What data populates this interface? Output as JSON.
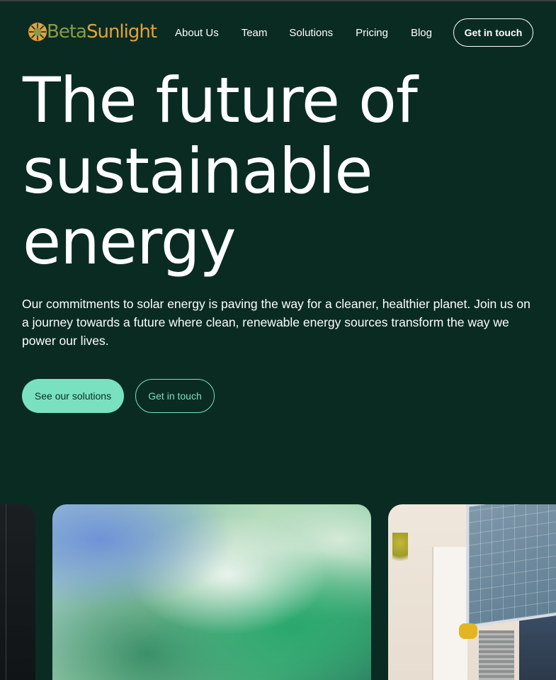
{
  "brand": {
    "name_part1": "Beta",
    "name_part2": "Sunlight",
    "logo_icon": "sun-icon",
    "colors": {
      "part1": "#8a9a45",
      "part2": "#e3a23a"
    }
  },
  "nav": {
    "items": [
      {
        "label": "About Us"
      },
      {
        "label": "Team"
      },
      {
        "label": "Solutions"
      },
      {
        "label": "Pricing"
      },
      {
        "label": "Blog"
      }
    ],
    "cta_label": "Get in touch"
  },
  "hero": {
    "title": "The future of sustainable energy",
    "subtitle": "Our commitments to solar energy is paving the way for a cleaner, healthier planet. Join us on a journey towards a future where clean, renewable energy sources transform the way we power our lives.",
    "primary_button": "See our solutions",
    "secondary_button": "Get in touch"
  },
  "colors": {
    "background": "#0a2b22",
    "accent": "#79e1bf",
    "text": "#ffffff"
  }
}
